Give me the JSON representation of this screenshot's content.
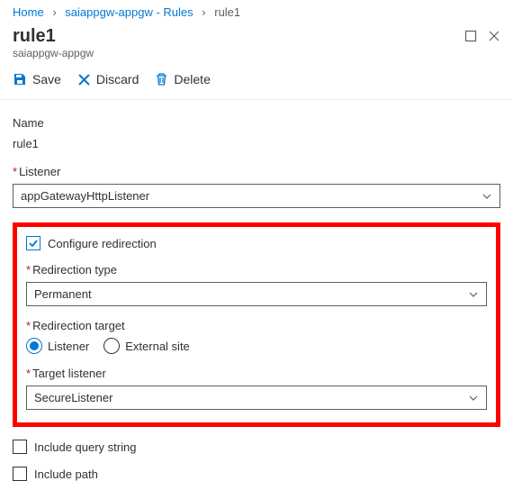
{
  "breadcrumb": {
    "home": "Home",
    "parent": "saiappgw-appgw - Rules",
    "current": "rule1"
  },
  "header": {
    "title": "rule1",
    "subtitle": "saiappgw-appgw"
  },
  "toolbar": {
    "save": "Save",
    "discard": "Discard",
    "delete": "Delete"
  },
  "form": {
    "name_label": "Name",
    "name_value": "rule1",
    "listener_label": "Listener",
    "listener_value": "appGatewayHttpListener",
    "configure_redirection_label": "Configure redirection",
    "redirection_type_label": "Redirection type",
    "redirection_type_value": "Permanent",
    "redirection_target_label": "Redirection target",
    "target_option_listener": "Listener",
    "target_option_external": "External site",
    "target_listener_label": "Target listener",
    "target_listener_value": "SecureListener",
    "include_query_string_label": "Include query string",
    "include_path_label": "Include path"
  }
}
